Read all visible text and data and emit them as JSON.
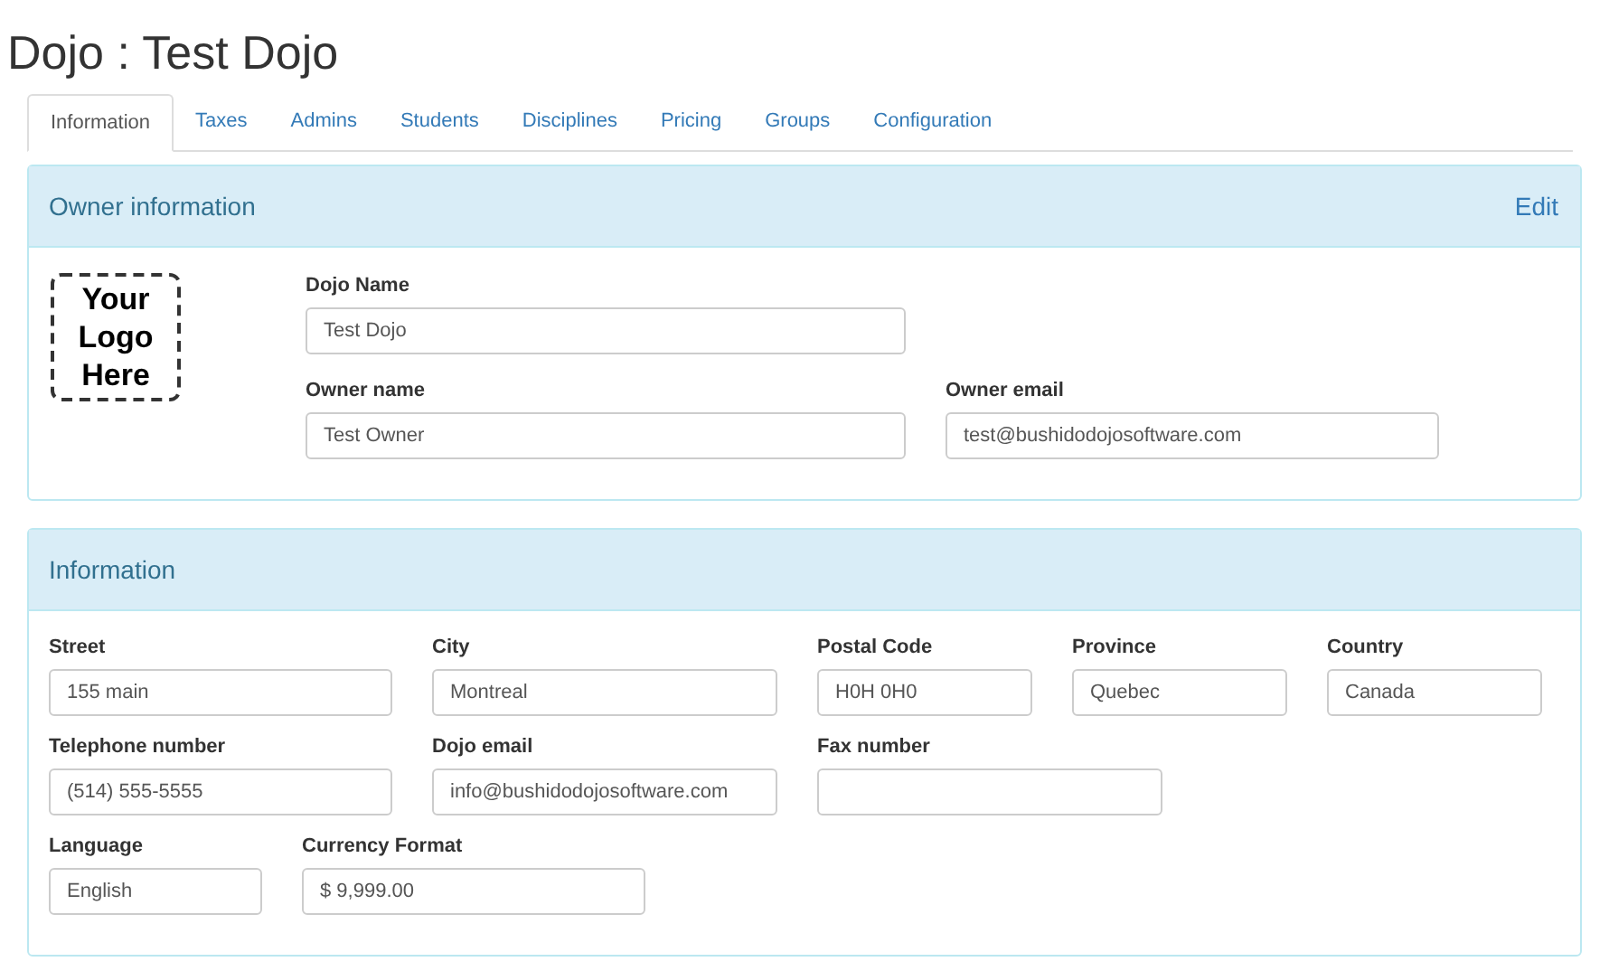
{
  "title": "Dojo : Test Dojo",
  "tabs": [
    {
      "label": "Information",
      "selected": true
    },
    {
      "label": "Taxes",
      "selected": false
    },
    {
      "label": "Admins",
      "selected": false
    },
    {
      "label": "Students",
      "selected": false
    },
    {
      "label": "Disciplines",
      "selected": false
    },
    {
      "label": "Pricing",
      "selected": false
    },
    {
      "label": "Groups",
      "selected": false
    },
    {
      "label": "Configuration",
      "selected": false
    }
  ],
  "owner_panel": {
    "heading": "Owner information",
    "edit_link": "Edit",
    "logo": "Your Logo Here",
    "rows": [
      [
        {
          "label": "Dojo Name",
          "value": "Test Dojo"
        }
      ],
      [
        {
          "label": "Owner name",
          "value": "Test Owner"
        },
        {
          "label": "Owner email",
          "value": "test@bushidodojosoftware.com"
        }
      ]
    ]
  },
  "info_panel": {
    "heading": "Information",
    "rows": [
      [
        {
          "label": "Street",
          "value": "155 main"
        },
        {
          "label": "City",
          "value": "Montreal"
        },
        {
          "label": "Postal Code",
          "value": "H0H 0H0"
        },
        {
          "label": "Province",
          "value": "Quebec"
        },
        {
          "label": "Country",
          "value": "Canada"
        }
      ],
      [
        {
          "label": "Telephone number",
          "value": "(514) 555-5555"
        },
        {
          "label": "Dojo email",
          "value": "info@bushidodojosoftware.com"
        },
        {
          "label": "Fax number"
        }
      ],
      [
        {
          "label": "Language",
          "value": "English"
        },
        {
          "label": "Currency Format",
          "value": "$ 9,999.00"
        }
      ]
    ]
  }
}
